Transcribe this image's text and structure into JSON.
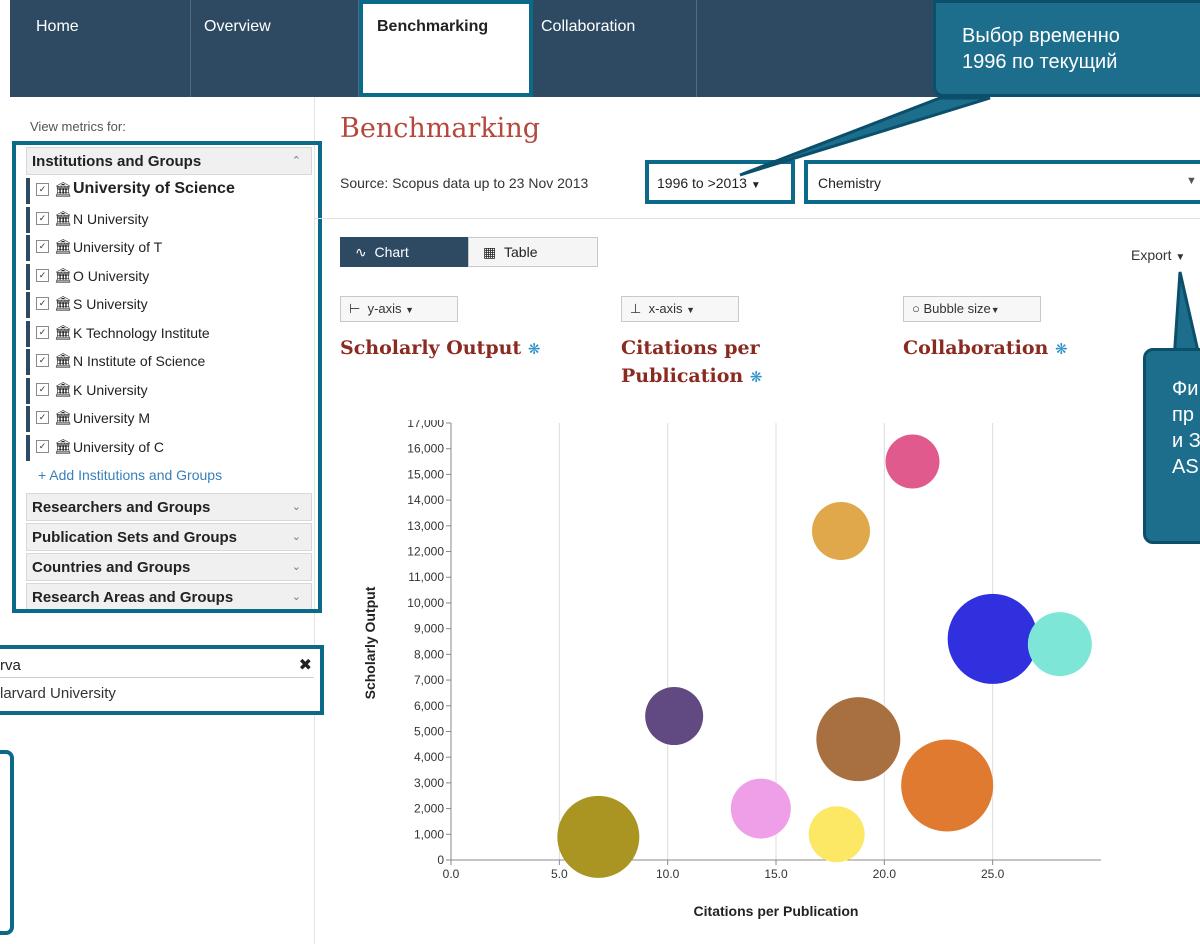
{
  "nav": {
    "tabs": [
      "Home",
      "Overview",
      "Benchmarking",
      "Collaboration"
    ],
    "active": "Benchmarking"
  },
  "sidebar": {
    "view_metrics": "View metrics for:",
    "sections": {
      "institutions": "Institutions and Groups",
      "researchers": "Researchers and Groups",
      "publication_sets": "Publication Sets and Groups",
      "countries": "Countries and Groups",
      "research_areas": "Research Areas and Groups"
    },
    "institutions": [
      "University of Science",
      "N University",
      "University of T",
      "O University",
      "S University",
      "K Technology Institute",
      "N Institute of Science",
      "K University",
      "University M",
      "University of C"
    ],
    "add_link": "+ Add Institutions and Groups",
    "search": {
      "value": "rva",
      "suggestion": "larvard University"
    }
  },
  "main": {
    "title": "Benchmarking",
    "source": "Source: Scopus data up to 23 Nov 2013",
    "date_range": "1996 to >2013",
    "subject": "Chemistry",
    "view_chart": "Chart",
    "view_table": "Table",
    "export": "Export",
    "yaxis_btn": "y-axis",
    "xaxis_btn": "x-axis",
    "bubble_btn": "Bubble size",
    "metric_y": "Scholarly Output",
    "metric_x_line1": "Citations per",
    "metric_x_line2": "Publication",
    "metric_size": "Collaboration"
  },
  "callouts": {
    "top_right_line1": "Выбор временно",
    "top_right_line2": "1996 по текущий",
    "right_line1": "Фи",
    "right_line2": "пр",
    "right_line3": "и З",
    "right_line4": "AS"
  },
  "colors": {
    "nav": "#2e4a62",
    "accent": "#0b6a8a",
    "title": "#b5483d",
    "metric": "#8b2a20",
    "callout": "#1d6d8c"
  },
  "chart_data": {
    "type": "scatter",
    "xlabel": "Citations per Publication",
    "ylabel": "Scholarly Output",
    "xlim": [
      0,
      30
    ],
    "ylim": [
      0,
      17000
    ],
    "xticks": [
      0,
      5,
      10,
      15,
      20,
      25
    ],
    "yticks": [
      0,
      1000,
      2000,
      3000,
      4000,
      5000,
      6000,
      7000,
      8000,
      9000,
      10000,
      11000,
      12000,
      13000,
      14000,
      15000,
      16000,
      17000
    ],
    "grid": true,
    "points": [
      {
        "x": 21.3,
        "y": 15500,
        "r": 27,
        "color": "#e05a8e"
      },
      {
        "x": 18.0,
        "y": 12800,
        "r": 29,
        "color": "#e0a84a"
      },
      {
        "x": 25.0,
        "y": 8600,
        "r": 45,
        "color": "#3030de"
      },
      {
        "x": 28.1,
        "y": 8400,
        "r": 32,
        "color": "#7ee6d6"
      },
      {
        "x": 10.3,
        "y": 5600,
        "r": 29,
        "color": "#614a82"
      },
      {
        "x": 18.8,
        "y": 4700,
        "r": 42,
        "color": "#a86f40"
      },
      {
        "x": 22.9,
        "y": 2900,
        "r": 46,
        "color": "#e07a30"
      },
      {
        "x": 14.3,
        "y": 2000,
        "r": 30,
        "color": "#ef9ee8"
      },
      {
        "x": 17.8,
        "y": 1000,
        "r": 28,
        "color": "#fde866"
      },
      {
        "x": 6.8,
        "y": 900,
        "r": 41,
        "color": "#ab9522"
      }
    ]
  }
}
